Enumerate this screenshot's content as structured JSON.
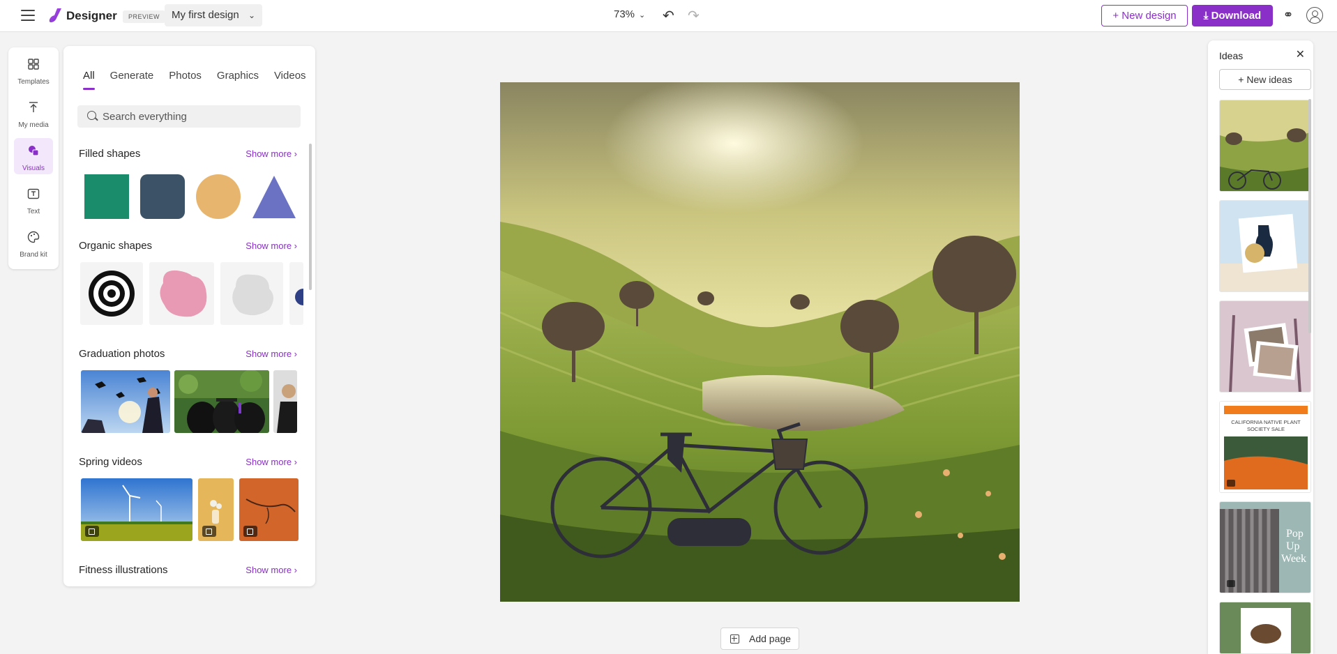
{
  "topbar": {
    "app_name": "Designer",
    "preview_badge": "PREVIEW",
    "design_name": "My first design",
    "zoom": "73%",
    "new_design_label": "New design",
    "download_label": "Download"
  },
  "rail": {
    "items": [
      {
        "label": "Templates",
        "icon": "templates-icon"
      },
      {
        "label": "My media",
        "icon": "upload-icon"
      },
      {
        "label": "Visuals",
        "icon": "visuals-icon",
        "active": true
      },
      {
        "label": "Text",
        "icon": "text-icon"
      },
      {
        "label": "Brand kit",
        "icon": "brand-kit-icon"
      }
    ]
  },
  "panel": {
    "tabs": [
      {
        "label": "All",
        "active": true
      },
      {
        "label": "Generate"
      },
      {
        "label": "Photos"
      },
      {
        "label": "Graphics"
      },
      {
        "label": "Videos"
      }
    ],
    "search_placeholder": "Search everything",
    "show_more_label": "Show more",
    "sections": [
      {
        "title": "Filled shapes"
      },
      {
        "title": "Organic shapes"
      },
      {
        "title": "Graduation photos"
      },
      {
        "title": "Spring videos"
      },
      {
        "title": "Fitness illustrations"
      }
    ],
    "shape_colors": {
      "square": "#1a8c6c",
      "rounded_square": "#3c5266",
      "circle": "#e8b56e",
      "triangle": "#6b72c4"
    }
  },
  "canvas": {
    "add_page_label": "Add page"
  },
  "ideas": {
    "title": "Ideas",
    "new_ideas_label": "New ideas",
    "cards": [
      {
        "kind": "landscape"
      },
      {
        "kind": "swimwear"
      },
      {
        "kind": "lavender-photos"
      },
      {
        "kind": "plant-sale",
        "text": "CALIFORNIA NATIVE PLANT SOCIETY SALE"
      },
      {
        "kind": "popup",
        "text": "Pop Up Week"
      },
      {
        "kind": "coffee"
      }
    ]
  },
  "colors": {
    "accent": "#8b2fc9"
  }
}
